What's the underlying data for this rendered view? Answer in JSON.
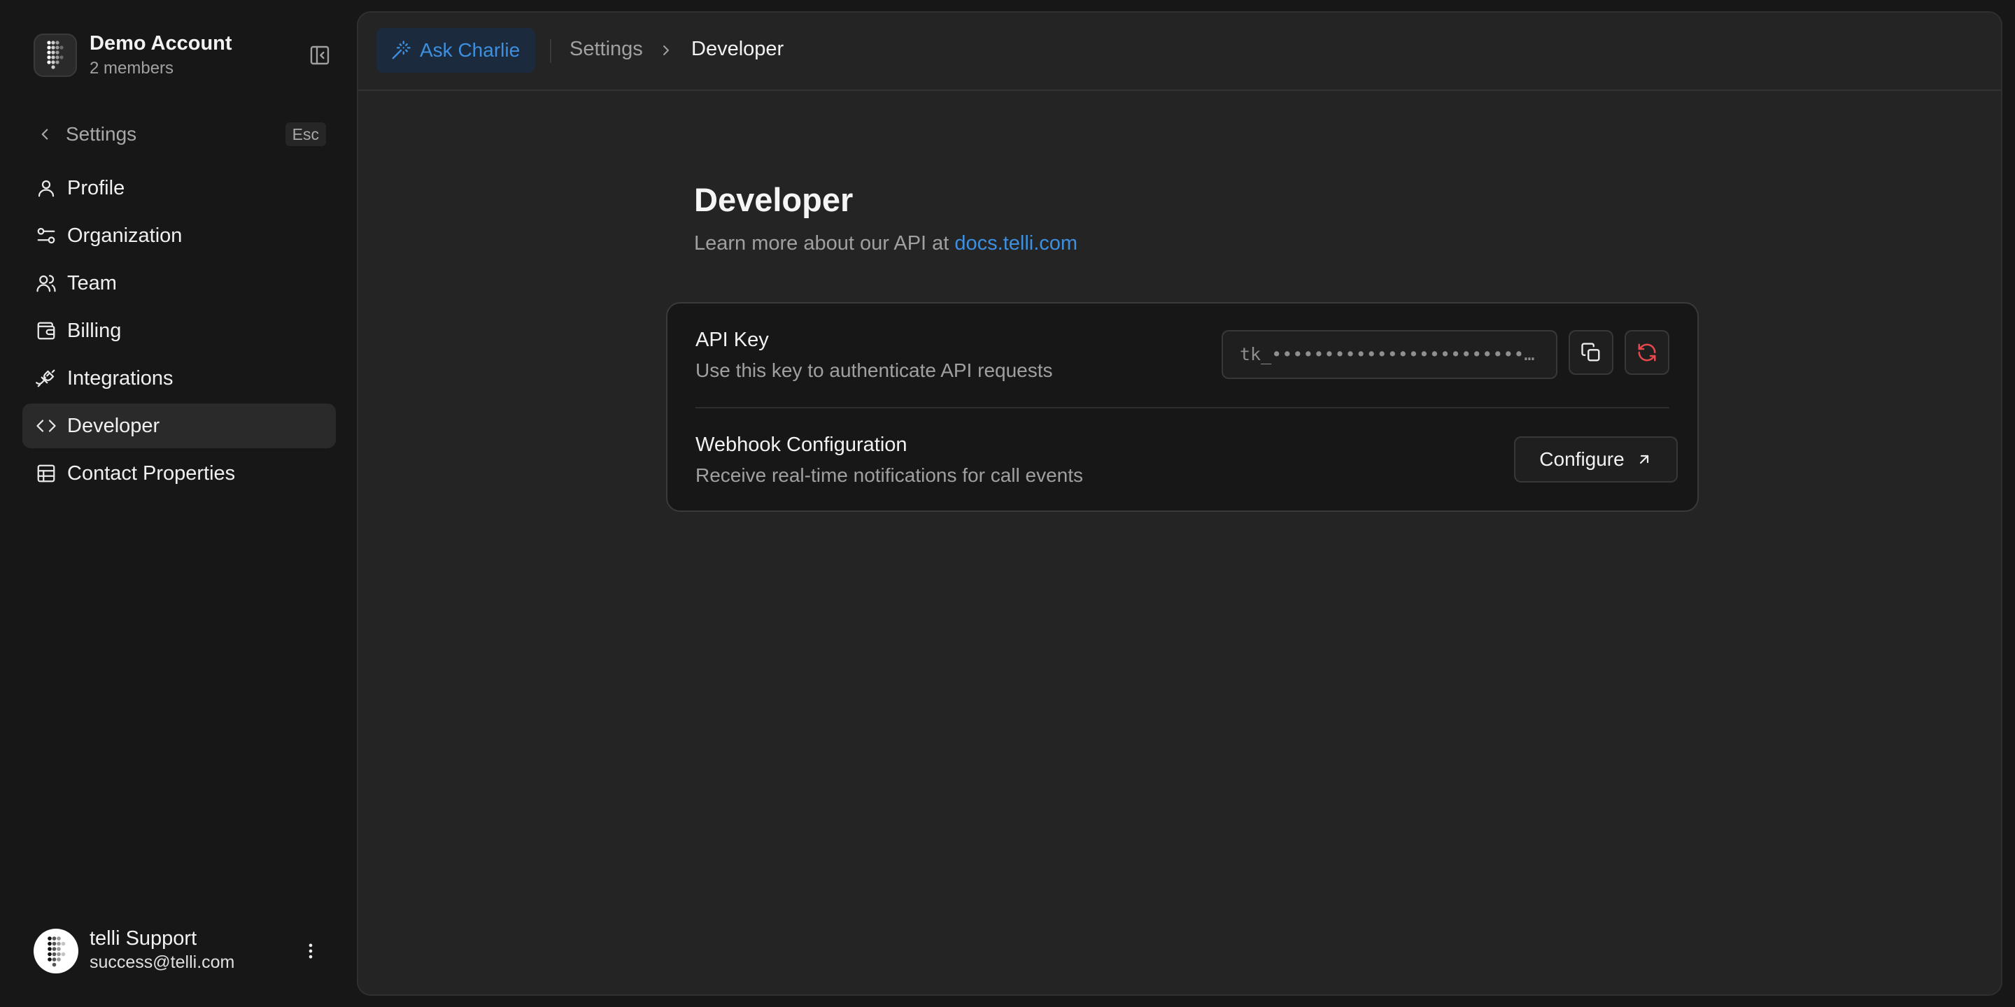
{
  "sidebar": {
    "account": {
      "name": "Demo Account",
      "members": "2 members"
    },
    "back": {
      "label": "Settings",
      "shortcut": "Esc"
    },
    "items": [
      {
        "label": "Profile",
        "icon": "user-icon",
        "active": false
      },
      {
        "label": "Organization",
        "icon": "sliders-icon",
        "active": false
      },
      {
        "label": "Team",
        "icon": "users-icon",
        "active": false
      },
      {
        "label": "Billing",
        "icon": "wallet-icon",
        "active": false
      },
      {
        "label": "Integrations",
        "icon": "plug-icon",
        "active": false
      },
      {
        "label": "Developer",
        "icon": "code-icon",
        "active": true
      },
      {
        "label": "Contact Properties",
        "icon": "table-icon",
        "active": false
      }
    ],
    "user": {
      "name": "telli Support",
      "email": "success@telli.com"
    }
  },
  "topbar": {
    "ask_label": "Ask Charlie",
    "breadcrumb": {
      "parent": "Settings",
      "current": "Developer"
    }
  },
  "page": {
    "title": "Developer",
    "subtitle_prefix": "Learn more about our API at",
    "subtitle_link": "docs.telli.com"
  },
  "api_key": {
    "title": "API Key",
    "description": "Use this key to authenticate API requests",
    "masked_value": "tk_••••••••••••••••••••••••••••"
  },
  "webhook": {
    "title": "Webhook Configuration",
    "description": "Receive real-time notifications for call events",
    "button_label": "Configure"
  },
  "colors": {
    "accent": "#3d8fe0",
    "danger": "#e5484d",
    "background": "#171717",
    "panel": "#242424"
  }
}
